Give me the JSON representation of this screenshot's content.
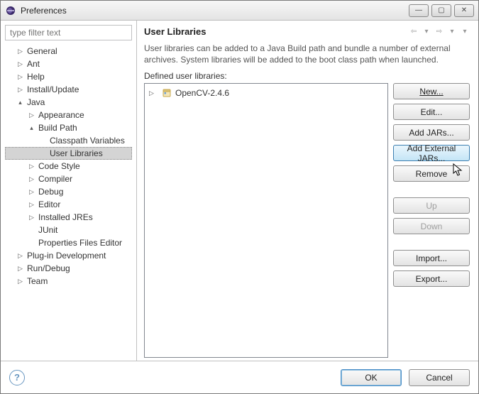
{
  "window": {
    "title": "Preferences"
  },
  "filter": {
    "placeholder": "type filter text"
  },
  "tree": {
    "general": "General",
    "ant": "Ant",
    "help": "Help",
    "install": "Install/Update",
    "java": "Java",
    "appearance": "Appearance",
    "buildpath": "Build Path",
    "classpath_vars": "Classpath Variables",
    "user_libs": "User Libraries",
    "code_style": "Code Style",
    "compiler": "Compiler",
    "debug": "Debug",
    "editor": "Editor",
    "installed_jres": "Installed JREs",
    "junit": "JUnit",
    "properties_editor": "Properties Files Editor",
    "plugin_dev": "Plug-in Development",
    "run_debug": "Run/Debug",
    "team": "Team"
  },
  "page": {
    "title": "User Libraries",
    "description": "User libraries can be added to a Java Build path and bundle a number of external archives. System libraries will be added to the boot class path when launched.",
    "defined_label": "Defined user libraries:",
    "entries": [
      {
        "label": "OpenCV-2.4.6"
      }
    ]
  },
  "buttons": {
    "new": "New...",
    "edit": "Edit...",
    "add_jars": "Add JARs...",
    "add_ext_jars": "Add External JARs...",
    "remove": "Remove",
    "up": "Up",
    "down": "Down",
    "import": "Import...",
    "export": "Export..."
  },
  "footer": {
    "ok": "OK",
    "cancel": "Cancel"
  }
}
